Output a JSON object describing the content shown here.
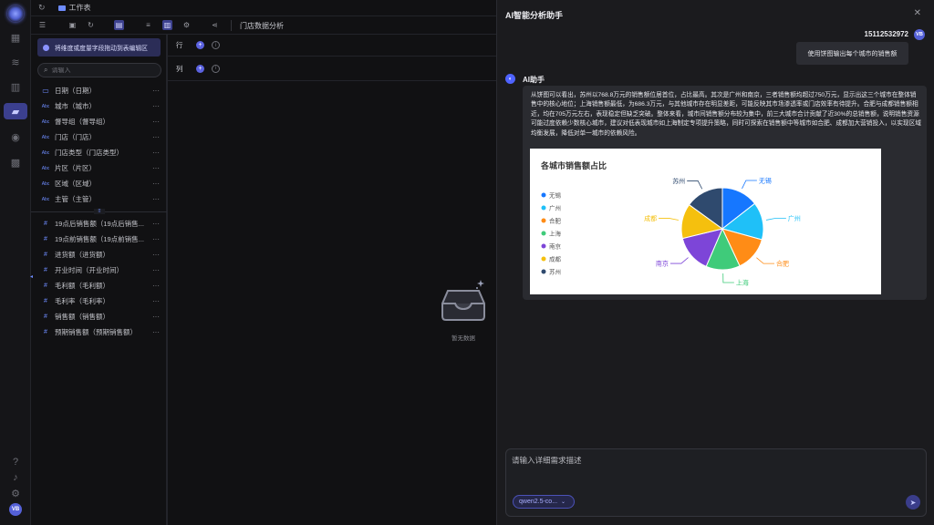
{
  "topbar": {
    "crumb": "工作表"
  },
  "toolbar": {
    "sheet_name": "门店数据分析"
  },
  "fields": {
    "drag_tip": "将维度或度量字段拖动到表编辑区",
    "search_placeholder": "请输入",
    "dimensions": [
      {
        "label": "日期（日期）",
        "icon": "calendar-icon"
      },
      {
        "label": "城市（城市）",
        "icon": "abc-icon"
      },
      {
        "label": "督导组（督导组）",
        "icon": "abc-icon"
      },
      {
        "label": "门店（门店）",
        "icon": "abc-icon"
      },
      {
        "label": "门店类型（门店类型）",
        "icon": "abc-icon"
      },
      {
        "label": "片区（片区）",
        "icon": "abc-icon"
      },
      {
        "label": "区域（区域）",
        "icon": "abc-icon"
      },
      {
        "label": "主管（主管）",
        "icon": "abc-icon"
      }
    ],
    "measures": [
      {
        "label": "19点后销售额（19点后销售..."
      },
      {
        "label": "19点前销售额（19点前销售..."
      },
      {
        "label": "进货额（进货额）"
      },
      {
        "label": "开业时间（开业时间）"
      },
      {
        "label": "毛利额（毛利额）"
      },
      {
        "label": "毛利率（毛利率）"
      },
      {
        "label": "销售额（销售额）"
      },
      {
        "label": "预期销售额（预期销售额）"
      }
    ]
  },
  "canvas": {
    "row_label": "行",
    "col_label": "列",
    "empty_text": "暂无数据"
  },
  "chat": {
    "title": "AI智能分析助手",
    "user_name": "15112532972",
    "user_avatar": "VB",
    "user_message": "使用饼图输出每个城市的销售额",
    "ai_name": "AI助手",
    "ai_message": "从饼图可以看出，苏州以768.8万元的销售额位居首位，占比最高。其次是广州和南京，三者销售额均超过750万元，显示出这三个城市在整体销售中的核心地位；上海销售额最低，为686.3万元，与其他城市存在明显差距，可能反映其市场渗透率或门店效率有待提升。合肥与成都销售额相近，均在705万元左右，表现稳定但缺乏突破。整体来看，城市间销售额分布较为集中，前三大城市合计贡献了近30%的总销售额，说明销售资源可能过度依赖少数核心城市，建议对低表现城市如上海制定专项提升策略，同时可探索在销售额中等城市如合肥、成都加大营销投入，以实现区域均衡发展，降低对单一城市的依赖风险。",
    "input_placeholder": "请输入详细需求描述",
    "model": "qwen2.5-co..."
  },
  "rail": {
    "avatar": "VB"
  },
  "chart_data": {
    "type": "pie",
    "title": "各城市销售额占比",
    "legend_position": "left",
    "categories": [
      "无锡",
      "广州",
      "合肥",
      "上海",
      "南京",
      "成都",
      "苏州"
    ],
    "values": [
      740,
      760,
      705,
      686.3,
      755,
      705,
      768.8
    ],
    "colors": [
      "#1677ff",
      "#1fc0f8",
      "#ff8c16",
      "#3fcb7a",
      "#7d45d8",
      "#f5c00e",
      "#2f4a6e"
    ]
  }
}
